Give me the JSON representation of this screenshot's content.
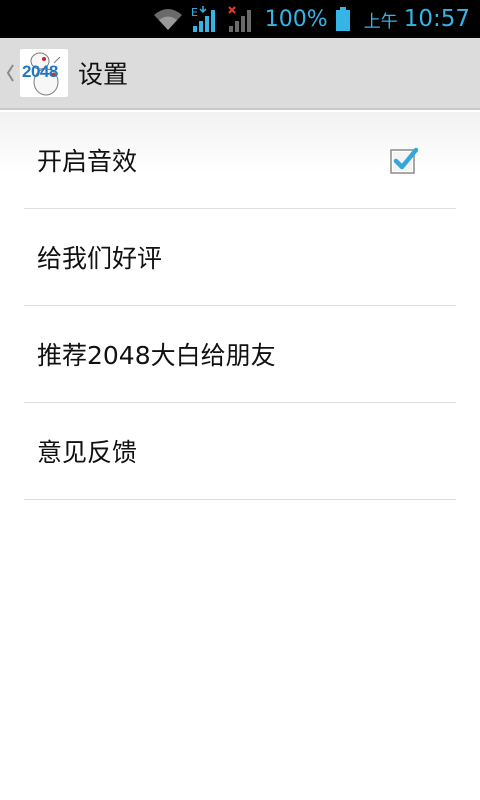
{
  "status_bar": {
    "battery_percent": "100%",
    "ampm": "上午",
    "time": "10:57",
    "network_type": "E",
    "icons": [
      "wifi-icon",
      "signal-icon",
      "no-signal-icon",
      "battery-icon"
    ],
    "accent_color": "#35b5e5"
  },
  "action_bar": {
    "app_icon_text": "2048",
    "title": "设置"
  },
  "settings": {
    "items": [
      {
        "label": "开启音效",
        "checked": true
      },
      {
        "label": "给我们好评"
      },
      {
        "label": "推荐2048大白给朋友"
      },
      {
        "label": "意见反馈"
      }
    ]
  }
}
